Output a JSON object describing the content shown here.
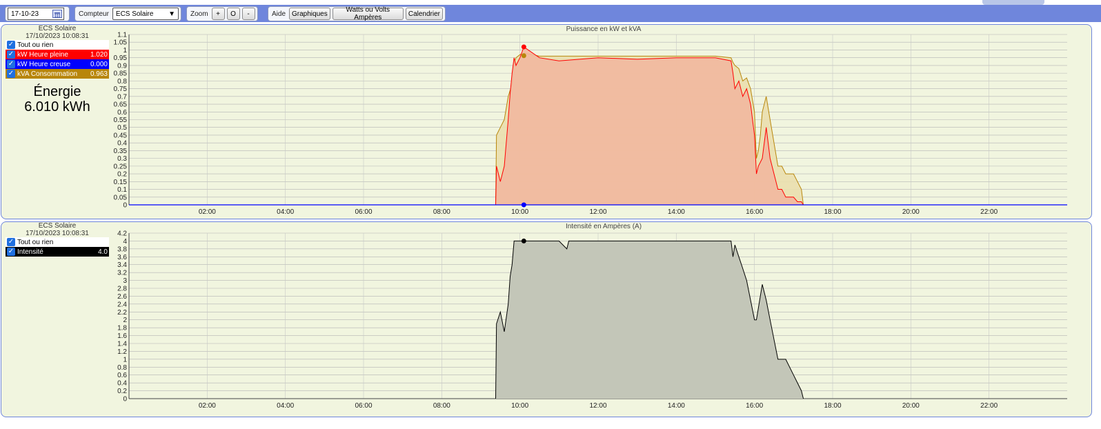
{
  "toolbar": {
    "date_value": "17-10-23",
    "compteur_label": "Compteur",
    "compteur_selected": "ECS Solaire",
    "zoom_label": "Zoom",
    "zoom_in": "+",
    "zoom_reset": "O",
    "zoom_out": "-",
    "aide_label": "Aide",
    "graphiques": "Graphiques",
    "watts_volts": "Watts ou Volts Ampères",
    "calendrier": "Calendrier"
  },
  "power_panel": {
    "name": "ECS Solaire",
    "timestamp": "17/10/2023 10:08:31",
    "toggle_all": "Tout ou rien",
    "legend": [
      {
        "label": "kW Heure pleine",
        "value": "1.020",
        "color": "#ff0000",
        "text_color": "#ffffff"
      },
      {
        "label": "kW Heure creuse",
        "value": "0.000",
        "color": "#0000ff",
        "text_color": "#ffffff"
      },
      {
        "label": "kVA Consommation",
        "value": "0.963",
        "color": "#b8860b",
        "text_color": "#ffffff"
      }
    ],
    "energy_label": "Énergie",
    "energy_value": "6.010 kWh"
  },
  "intensity_panel": {
    "name": "ECS Solaire",
    "timestamp": "17/10/2023 10:08:31",
    "toggle_all": "Tout ou rien",
    "legend": [
      {
        "label": "Intensité",
        "value": "4.0",
        "color": "#000000",
        "text_color": "#ffffff"
      }
    ]
  },
  "colors": {
    "toolbar_bg": "#6f86dc",
    "panel_bg": "#f1f5df",
    "kw_pleine": "#ff0000",
    "kw_pleine_fill": "#f2b89f",
    "kw_creuse": "#0000ff",
    "kva": "#b8860b",
    "kva_fill": "#eadfae",
    "intensite": "#000000",
    "intensite_fill": "#c3c6b8"
  },
  "chart_data": [
    {
      "type": "area",
      "title": "Puissance en kW et kVA",
      "x_unit": "hour",
      "xlim": [
        0,
        24
      ],
      "ylim": [
        0,
        1.1
      ],
      "y_ticks": [
        0,
        0.05,
        0.1,
        0.15,
        0.2,
        0.25,
        0.3,
        0.35,
        0.4,
        0.45,
        0.5,
        0.55,
        0.6,
        0.65,
        0.7,
        0.75,
        0.8,
        0.85,
        0.9,
        0.95,
        1,
        1.05,
        1.1
      ],
      "x_ticks": [
        "02:00",
        "04:00",
        "06:00",
        "08:00",
        "10:00",
        "12:00",
        "14:00",
        "16:00",
        "18:00",
        "20:00",
        "22:00"
      ],
      "x_tick_hours": [
        2,
        4,
        6,
        8,
        10,
        12,
        14,
        16,
        18,
        20,
        22
      ],
      "grid": true,
      "series": [
        {
          "name": "kVA Consommation",
          "x": [
            9.38,
            9.4,
            9.5,
            9.6,
            9.7,
            9.8,
            9.85,
            9.9,
            10.0,
            10.1,
            10.5,
            11.0,
            12.0,
            13.0,
            14.0,
            15.0,
            15.4,
            15.45,
            15.5,
            15.6,
            15.7,
            15.8,
            15.9,
            16.0,
            16.05,
            16.1,
            16.15,
            16.2,
            16.3,
            16.4,
            16.5,
            16.6,
            16.7,
            16.8,
            17.0,
            17.1,
            17.2,
            17.25
          ],
          "y": [
            0,
            0.45,
            0.5,
            0.55,
            0.7,
            0.78,
            0.92,
            0.95,
            0.97,
            0.98,
            0.96,
            0.96,
            0.96,
            0.96,
            0.96,
            0.96,
            0.95,
            0.92,
            0.9,
            0.88,
            0.8,
            0.82,
            0.75,
            0.6,
            0.3,
            0.35,
            0.45,
            0.6,
            0.7,
            0.55,
            0.4,
            0.25,
            0.25,
            0.2,
            0.2,
            0.15,
            0.1,
            0
          ]
        },
        {
          "name": "kW Heure pleine",
          "x": [
            9.38,
            9.4,
            9.5,
            9.6,
            9.7,
            9.75,
            9.8,
            9.85,
            9.9,
            10.0,
            10.1,
            10.5,
            11.0,
            12.0,
            13.0,
            14.0,
            15.0,
            15.4,
            15.45,
            15.5,
            15.6,
            15.7,
            15.8,
            15.9,
            16.0,
            16.05,
            16.1,
            16.2,
            16.3,
            16.4,
            16.5,
            16.6,
            16.7,
            16.8,
            17.0,
            17.1,
            17.2,
            17.25
          ],
          "y": [
            0,
            0.25,
            0.15,
            0.25,
            0.55,
            0.72,
            0.85,
            0.95,
            0.9,
            0.95,
            1.02,
            0.95,
            0.93,
            0.95,
            0.94,
            0.95,
            0.95,
            0.93,
            0.85,
            0.75,
            0.8,
            0.7,
            0.75,
            0.65,
            0.45,
            0.2,
            0.25,
            0.3,
            0.5,
            0.3,
            0.2,
            0.1,
            0.1,
            0.05,
            0.05,
            0.02,
            0.02,
            0
          ]
        },
        {
          "name": "kW Heure creuse",
          "x": [
            0,
            24
          ],
          "y": [
            0,
            0
          ]
        }
      ],
      "markers": [
        {
          "series": "kW Heure pleine",
          "x": 10.1,
          "y": 1.02
        },
        {
          "series": "kVA Consommation",
          "x": 10.1,
          "y": 0.963
        },
        {
          "series": "kW Heure creuse",
          "x": 10.1,
          "y": 0
        }
      ]
    },
    {
      "type": "area",
      "title": "Intensité en Ampères (A)",
      "x_unit": "hour",
      "xlim": [
        0,
        24
      ],
      "ylim": [
        0,
        4.2
      ],
      "y_ticks": [
        0,
        0.2,
        0.4,
        0.6,
        0.8,
        1,
        1.2,
        1.4,
        1.6,
        1.8,
        2,
        2.2,
        2.4,
        2.6,
        2.8,
        3,
        3.2,
        3.4,
        3.6,
        3.8,
        4,
        4.2
      ],
      "x_ticks": [
        "02:00",
        "04:00",
        "06:00",
        "08:00",
        "10:00",
        "12:00",
        "14:00",
        "16:00",
        "18:00",
        "20:00",
        "22:00"
      ],
      "x_tick_hours": [
        2,
        4,
        6,
        8,
        10,
        12,
        14,
        16,
        18,
        20,
        22
      ],
      "grid": true,
      "series": [
        {
          "name": "Intensité",
          "x": [
            9.38,
            9.4,
            9.5,
            9.6,
            9.7,
            9.75,
            9.8,
            9.85,
            10.0,
            11.0,
            11.2,
            11.25,
            12.0,
            13.0,
            14.0,
            15.0,
            15.4,
            15.45,
            15.5,
            15.6,
            15.7,
            15.8,
            15.9,
            16.0,
            16.05,
            16.2,
            16.3,
            16.4,
            16.5,
            16.6,
            16.7,
            16.8,
            17.0,
            17.1,
            17.2,
            17.25
          ],
          "y": [
            0,
            1.9,
            2.2,
            1.7,
            2.4,
            3.1,
            3.4,
            4.0,
            4.0,
            4.0,
            3.8,
            4.0,
            4.0,
            4.0,
            4.0,
            4.0,
            4.0,
            3.6,
            3.9,
            3.6,
            3.3,
            3.0,
            2.5,
            2.0,
            2.0,
            2.9,
            2.5,
            2.0,
            1.5,
            1.0,
            1.0,
            1.0,
            0.6,
            0.4,
            0.2,
            0
          ]
        }
      ],
      "markers": [
        {
          "series": "Intensité",
          "x": 10.1,
          "y": 4.0
        }
      ]
    }
  ]
}
